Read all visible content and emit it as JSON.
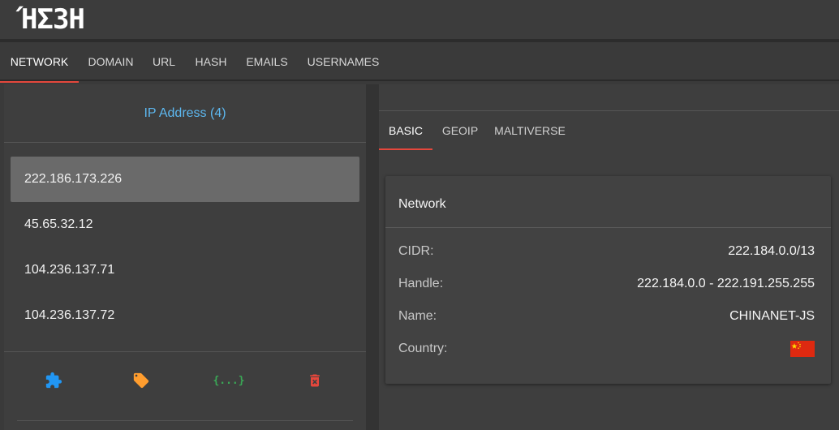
{
  "app": {
    "logo": "ΉΣ3Н"
  },
  "main_tabs": [
    {
      "label": "NETWORK",
      "active": true
    },
    {
      "label": "DOMAIN"
    },
    {
      "label": "URL"
    },
    {
      "label": "HASH"
    },
    {
      "label": "EMAILS"
    },
    {
      "label": "USERNAMES"
    }
  ],
  "left": {
    "title": "IP Address (4)",
    "items": [
      {
        "ip": "222.186.173.226",
        "selected": true
      },
      {
        "ip": "45.65.32.12"
      },
      {
        "ip": "104.236.137.71"
      },
      {
        "ip": "104.236.137.72"
      }
    ],
    "actions": [
      {
        "icon": "puzzle-icon",
        "color": "#2196f3"
      },
      {
        "icon": "tag-icon",
        "color": "#ff9d2e"
      },
      {
        "icon": "json-braces-icon",
        "color": "#3aa856",
        "glyph": "{...}"
      },
      {
        "icon": "trash-icon",
        "color": "#e5473c"
      }
    ]
  },
  "right": {
    "sub_tabs": [
      {
        "label": "BASIC",
        "active": true
      },
      {
        "label": "GEOIP"
      },
      {
        "label": "MALTIVERSE"
      }
    ],
    "card": {
      "title": "Network",
      "fields": [
        {
          "key": "CIDR:",
          "value": "222.184.0.0/13"
        },
        {
          "key": "Handle:",
          "value": "222.184.0.0 - 222.191.255.255"
        },
        {
          "key": "Name:",
          "value": "CHINANET-JS"
        },
        {
          "key": "Country:",
          "value": "",
          "flag": "china-flag-icon"
        }
      ]
    }
  },
  "colors": {
    "accent": "#e5473c",
    "link": "#5db8f0",
    "background": "#3a3a3a",
    "panel": "#3e3e3e",
    "card": "#424242"
  }
}
